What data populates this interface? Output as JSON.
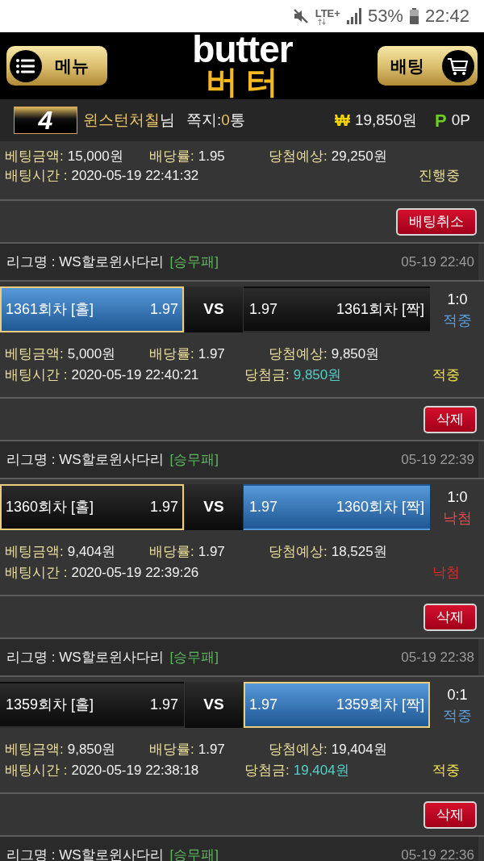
{
  "status_bar": {
    "network": "LTE+",
    "battery": "53%",
    "time": "22:42"
  },
  "header": {
    "menu_button": "메뉴",
    "logo_top": "butter",
    "logo_bottom": "버터",
    "bet_button": "배팅"
  },
  "user_bar": {
    "level": "4",
    "username": "윈스턴처칠",
    "honorific": "님",
    "messages_label": "쪽지:",
    "messages_count": "0",
    "messages_unit": "통",
    "currency_symbol": "₩",
    "balance": "19,850원",
    "points_symbol": "P",
    "points": "0P"
  },
  "bets": [
    {
      "detail_rows": [
        {
          "items": [
            {
              "label": "베팅금액:",
              "value": "15,000원",
              "highlight": false
            },
            {
              "label": "배당률:",
              "value": "1.95",
              "highlight": false
            },
            {
              "label": "당첨예상:",
              "value": "29,250원",
              "highlight": false
            }
          ]
        },
        {
          "items": [
            {
              "label": "배팅시간 :",
              "value": "2020-05-19 22:41:32",
              "highlight": false
            }
          ]
        }
      ],
      "status": {
        "text": "진행중",
        "kind": "pending"
      },
      "action_button": "배팅취소"
    },
    {
      "league": {
        "name": "리그명 : WS할로윈사다리",
        "tag": "[승무패]",
        "time": "05-19 22:40"
      },
      "match": {
        "home": {
          "name": "1361회차 [홀]",
          "odds": "1.97",
          "selected": true,
          "won": true
        },
        "vs": "VS",
        "away": {
          "name": "1361회차 [짝]",
          "odds": "1.97",
          "selected": false,
          "won": false
        },
        "score": "1:0",
        "result": {
          "text": "적중",
          "kind": "hit"
        }
      },
      "detail_rows": [
        {
          "items": [
            {
              "label": "베팅금액:",
              "value": "5,000원",
              "highlight": false
            },
            {
              "label": "배당률:",
              "value": "1.97",
              "highlight": false
            },
            {
              "label": "당첨예상:",
              "value": "9,850원",
              "highlight": false
            }
          ]
        },
        {
          "items": [
            {
              "label": "배팅시간 :",
              "value": "2020-05-19 22:40:21",
              "highlight": false
            },
            {
              "label": "당첨금:",
              "value": "9,850원",
              "highlight": true
            }
          ]
        }
      ],
      "status": {
        "text": "적중",
        "kind": "hit"
      },
      "action_button": "삭제"
    },
    {
      "league": {
        "name": "리그명 : WS할로윈사다리",
        "tag": "[승무패]",
        "time": "05-19 22:39"
      },
      "match": {
        "home": {
          "name": "1360회차 [홀]",
          "odds": "1.97",
          "selected": true,
          "won": false
        },
        "vs": "VS",
        "away": {
          "name": "1360회차 [짝]",
          "odds": "1.97",
          "selected": false,
          "won": true
        },
        "score": "1:0",
        "result": {
          "text": "낙첨",
          "kind": "miss"
        }
      },
      "detail_rows": [
        {
          "items": [
            {
              "label": "베팅금액:",
              "value": "9,404원",
              "highlight": false
            },
            {
              "label": "배당률:",
              "value": "1.97",
              "highlight": false
            },
            {
              "label": "당첨예상:",
              "value": "18,525원",
              "highlight": false
            }
          ]
        },
        {
          "items": [
            {
              "label": "배팅시간 :",
              "value": "2020-05-19 22:39:26",
              "highlight": false
            }
          ]
        }
      ],
      "status": {
        "text": "낙첨",
        "kind": "miss"
      },
      "action_button": "삭제"
    },
    {
      "league": {
        "name": "리그명 : WS할로윈사다리",
        "tag": "[승무패]",
        "time": "05-19 22:38"
      },
      "match": {
        "home": {
          "name": "1359회차 [홀]",
          "odds": "1.97",
          "selected": false,
          "won": false
        },
        "vs": "VS",
        "away": {
          "name": "1359회차 [짝]",
          "odds": "1.97",
          "selected": true,
          "won": true
        },
        "score": "0:1",
        "result": {
          "text": "적중",
          "kind": "hit"
        }
      },
      "detail_rows": [
        {
          "items": [
            {
              "label": "베팅금액:",
              "value": "9,850원",
              "highlight": false
            },
            {
              "label": "배당률:",
              "value": "1.97",
              "highlight": false
            },
            {
              "label": "당첨예상:",
              "value": "19,404원",
              "highlight": false
            }
          ]
        },
        {
          "items": [
            {
              "label": "배팅시간 :",
              "value": "2020-05-19 22:38:18",
              "highlight": false
            },
            {
              "label": "당첨금:",
              "value": "19,404원",
              "highlight": true
            }
          ]
        }
      ],
      "status": {
        "text": "적중",
        "kind": "hit"
      },
      "action_button": "삭제"
    },
    {
      "league": {
        "name": "리그명 : WS할로윈사다리",
        "tag": "[승무패]",
        "time": "05-19 22:36"
      }
    }
  ]
}
